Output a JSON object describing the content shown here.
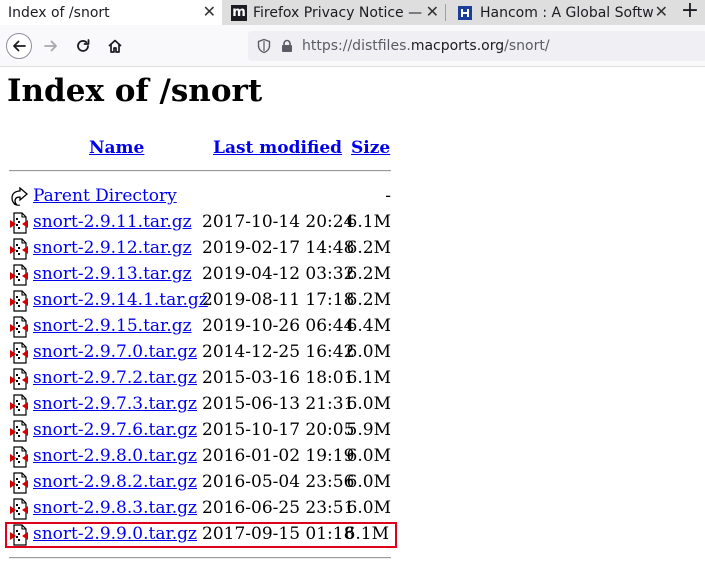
{
  "browser": {
    "tabs": [
      {
        "title": "Index of /snort",
        "active": true
      },
      {
        "title": "Firefox Privacy Notice —",
        "favicon": "mozilla-m-icon"
      },
      {
        "title": "Hancom : A Global Softw",
        "favicon": "hancom-icon"
      }
    ],
    "new_tab_label": "+",
    "close_label": "✕",
    "url_prefix": "https://distfiles.",
    "url_domain": "macports.org",
    "url_path": "/snort/"
  },
  "page": {
    "title": "Index of /snort",
    "columns": {
      "name": "Name",
      "modified": "Last modified",
      "size": "Size"
    },
    "parent": {
      "name": "Parent Directory",
      "size": "-",
      "icon": "back-arrow-icon"
    },
    "files": [
      {
        "name": "snort-2.9.11.tar.gz",
        "modified": "2017-10-14 20:24",
        "size": "6.1M"
      },
      {
        "name": "snort-2.9.12.tar.gz",
        "modified": "2019-02-17 14:48",
        "size": "6.2M"
      },
      {
        "name": "snort-2.9.13.tar.gz",
        "modified": "2019-04-12 03:32",
        "size": "6.2M"
      },
      {
        "name": "snort-2.9.14.1.tar.gz",
        "modified": "2019-08-11 17:18",
        "size": "6.2M"
      },
      {
        "name": "snort-2.9.15.tar.gz",
        "modified": "2019-10-26 06:44",
        "size": "6.4M"
      },
      {
        "name": "snort-2.9.7.0.tar.gz",
        "modified": "2014-12-25 16:42",
        "size": "6.0M"
      },
      {
        "name": "snort-2.9.7.2.tar.gz",
        "modified": "2015-03-16 18:01",
        "size": "6.1M"
      },
      {
        "name": "snort-2.9.7.3.tar.gz",
        "modified": "2015-06-13 21:31",
        "size": "6.0M"
      },
      {
        "name": "snort-2.9.7.6.tar.gz",
        "modified": "2015-10-17 20:05",
        "size": "5.9M"
      },
      {
        "name": "snort-2.9.8.0.tar.gz",
        "modified": "2016-01-02 19:19",
        "size": "6.0M"
      },
      {
        "name": "snort-2.9.8.2.tar.gz",
        "modified": "2016-05-04 23:56",
        "size": "6.0M"
      },
      {
        "name": "snort-2.9.8.3.tar.gz",
        "modified": "2016-06-25 23:51",
        "size": "6.0M"
      },
      {
        "name": "snort-2.9.9.0.tar.gz",
        "modified": "2017-09-15 01:18",
        "size": "6.1M",
        "highlighted": true
      }
    ],
    "file_icon": "compressed-file-icon",
    "link_color": "#0000ee",
    "highlight_color": "#e0001b"
  }
}
